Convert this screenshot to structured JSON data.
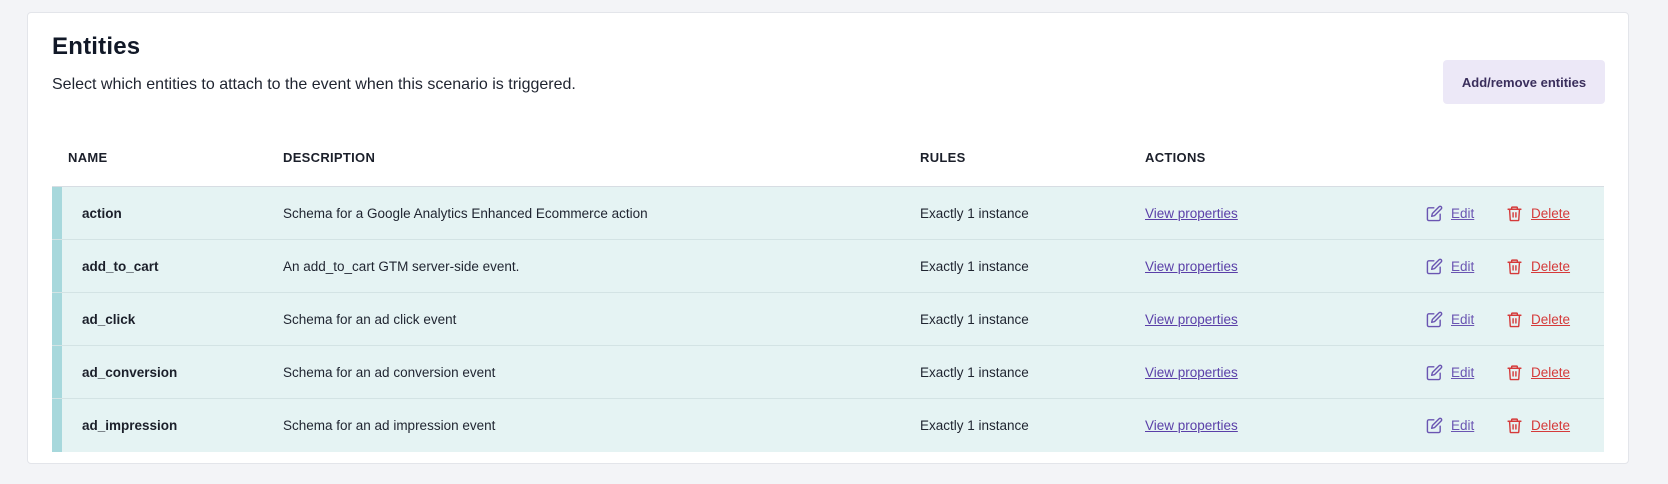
{
  "header": {
    "title": "Entities",
    "subtitle": "Select which entities to attach to the event when this scenario is triggered.",
    "add_button_label": "Add/remove entities"
  },
  "table": {
    "columns": {
      "name": "NAME",
      "description": "DESCRIPTION",
      "rules": "RULES",
      "actions": "ACTIONS"
    },
    "rows": [
      {
        "name": "action",
        "description": "Schema for a Google Analytics Enhanced Ecommerce action",
        "rules": "Exactly 1 instance",
        "view_label": "View properties",
        "edit_label": "Edit",
        "delete_label": "Delete"
      },
      {
        "name": "add_to_cart",
        "description": "An add_to_cart GTM server-side event.",
        "rules": "Exactly 1 instance",
        "view_label": "View properties",
        "edit_label": "Edit",
        "delete_label": "Delete"
      },
      {
        "name": "ad_click",
        "description": "Schema for an ad click event",
        "rules": "Exactly 1 instance",
        "view_label": "View properties",
        "edit_label": "Edit",
        "delete_label": "Delete"
      },
      {
        "name": "ad_conversion",
        "description": "Schema for an ad conversion event",
        "rules": "Exactly 1 instance",
        "view_label": "View properties",
        "edit_label": "Edit",
        "delete_label": "Delete"
      },
      {
        "name": "ad_impression",
        "description": "Schema for an ad impression event",
        "rules": "Exactly 1 instance",
        "view_label": "View properties",
        "edit_label": "Edit",
        "delete_label": "Delete"
      }
    ]
  },
  "icons": {
    "edit": "edit-icon",
    "delete": "trash-icon"
  },
  "colors": {
    "row_background": "#e5f3f3",
    "row_accent": "#a7d8dc",
    "link_purple": "#5a3fa8",
    "delete_red": "#d53a3a",
    "button_background": "#ece8f7"
  }
}
